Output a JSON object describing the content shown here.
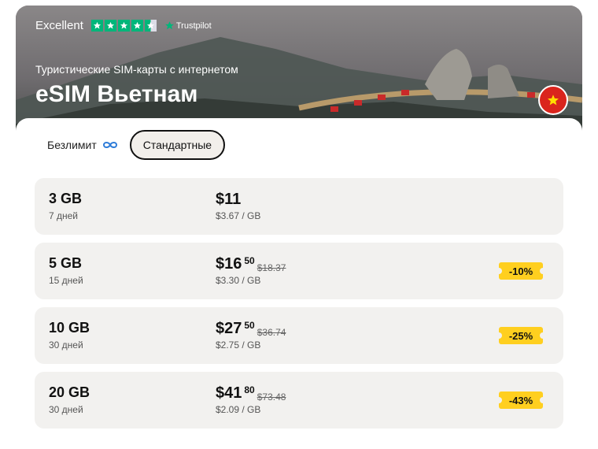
{
  "hero": {
    "rating_label": "Excellent",
    "trustpilot": "Trustpilot",
    "subtitle": "Туристические SIM-карты с интернетом",
    "title": "eSIM Вьетнам"
  },
  "tabs": [
    {
      "label": "Безлимит",
      "selected": false
    },
    {
      "label": "Стандартные",
      "selected": true
    }
  ],
  "plans": [
    {
      "gb": "3 GB",
      "days": "7 дней",
      "price": "$11",
      "cents": "",
      "old": "",
      "per": "$3.67 / GB",
      "discount": ""
    },
    {
      "gb": "5 GB",
      "days": "15 дней",
      "price": "$16",
      "cents": "50",
      "old": "$18.37",
      "per": "$3.30 / GB",
      "discount": "-10%"
    },
    {
      "gb": "10 GB",
      "days": "30 дней",
      "price": "$27",
      "cents": "50",
      "old": "$36.74",
      "per": "$2.75 / GB",
      "discount": "-25%"
    },
    {
      "gb": "20 GB",
      "days": "30 дней",
      "price": "$41",
      "cents": "80",
      "old": "$73.48",
      "per": "$2.09 / GB",
      "discount": "-43%"
    }
  ],
  "colors": {
    "trustpilot_green": "#00b67a",
    "badge_yellow": "#ffcf1f",
    "flag_red": "#da251d",
    "card_bg": "#f2f1ef"
  },
  "icons": [
    "star-icon",
    "infinity-icon",
    "vietnam-flag-icon"
  ]
}
